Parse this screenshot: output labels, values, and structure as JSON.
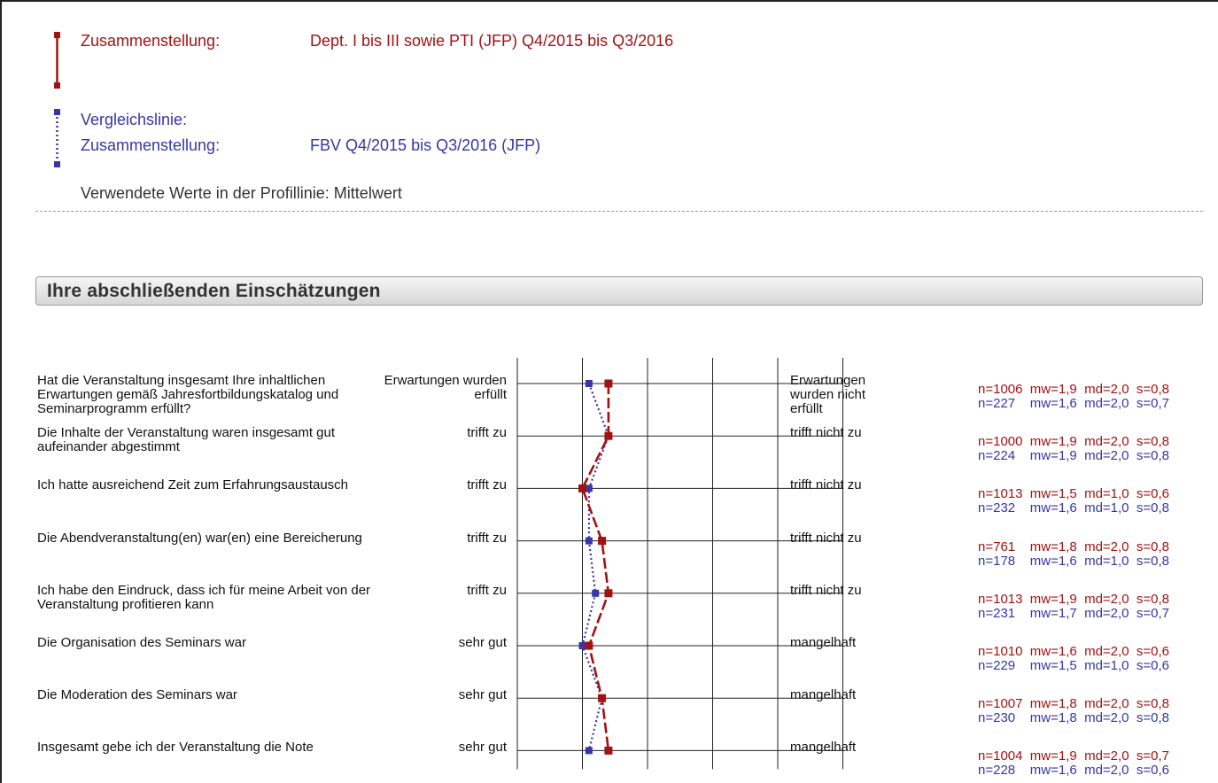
{
  "legend": {
    "main": {
      "label": "Zusammenstellung:",
      "value": "Dept. I bis III sowie PTI (JFP) Q4/2015 bis Q3/2016"
    },
    "comparison": {
      "title": "Vergleichslinie:",
      "label": "Zusammenstellung:",
      "value": "FBV Q4/2015 bis Q3/2016 (JFP)"
    },
    "values_note": "Verwendete Werte in der Profillinie: Mittelwert"
  },
  "section": {
    "title": "Ihre abschließenden Einschätzungen"
  },
  "colors": {
    "main": "#a31212",
    "comparison": "#3636a6"
  },
  "scale": {
    "points": 5
  },
  "questions": [
    {
      "text": "Hat die Veranstaltung insgesamt Ihre inhaltlichen Erwartungen gemäß Jahresfortbildungskatalog und Seminarprogramm erfüllt?",
      "left": "Erwartungen wurden erfüllt",
      "right": "Erwartungen wurden nicht erfüllt",
      "main_stat": "n=1006  mw=1,9  md=2,0  s=0,8",
      "comp_stat": "n=227    mw=1,6  md=2,0  s=0,7",
      "main_mean": 1.9,
      "comp_mean": 1.6
    },
    {
      "text": "Die Inhalte der Veranstaltung waren insgesamt gut aufeinander abgestimmt",
      "left": "trifft zu",
      "right": "trifft nicht zu",
      "main_stat": "n=1000  mw=1,9  md=2,0  s=0,8",
      "comp_stat": "n=224    mw=1,9  md=2,0  s=0,8",
      "main_mean": 1.9,
      "comp_mean": 1.9
    },
    {
      "text": "Ich hatte ausreichend Zeit zum Erfahrungsaustausch",
      "left": "trifft zu",
      "right": "trifft nicht zu",
      "main_stat": "n=1013  mw=1,5  md=1,0  s=0,6",
      "comp_stat": "n=232    mw=1,6  md=1,0  s=0,8",
      "main_mean": 1.5,
      "comp_mean": 1.6
    },
    {
      "text": "Die Abendveranstaltung(en) war(en) eine Bereicherung",
      "left": "trifft zu",
      "right": "trifft nicht zu",
      "main_stat": "n=761    mw=1,8  md=2,0  s=0,8",
      "comp_stat": "n=178    mw=1,6  md=1,0  s=0,8",
      "main_mean": 1.8,
      "comp_mean": 1.6
    },
    {
      "text": "Ich habe den Eindruck, dass ich für meine Arbeit von der Veranstaltung profitieren kann",
      "left": "trifft zu",
      "right": "trifft nicht zu",
      "main_stat": "n=1013  mw=1,9  md=2,0  s=0,8",
      "comp_stat": "n=231    mw=1,7  md=2,0  s=0,7",
      "main_mean": 1.9,
      "comp_mean": 1.7
    },
    {
      "text": "Die Organisation des Seminars war",
      "left": "sehr gut",
      "right": "mangelhaft",
      "main_stat": "n=1010  mw=1,6  md=2,0  s=0,6",
      "comp_stat": "n=229    mw=1,5  md=1,0  s=0,6",
      "main_mean": 1.6,
      "comp_mean": 1.5
    },
    {
      "text": "Die Moderation des Seminars war",
      "left": "sehr gut",
      "right": "mangelhaft",
      "main_stat": "n=1007  mw=1,8  md=2,0  s=0,8",
      "comp_stat": "n=230    mw=1,8  md=2,0  s=0,8",
      "main_mean": 1.8,
      "comp_mean": 1.8
    },
    {
      "text": "Insgesamt gebe ich der Veranstaltung die Note",
      "left": "sehr gut",
      "right": "mangelhaft",
      "main_stat": "n=1004  mw=1,9  md=2,0  s=0,7",
      "comp_stat": "n=228    mw=1,6  md=2,0  s=0,6",
      "main_mean": 1.9,
      "comp_mean": 1.6
    }
  ]
}
